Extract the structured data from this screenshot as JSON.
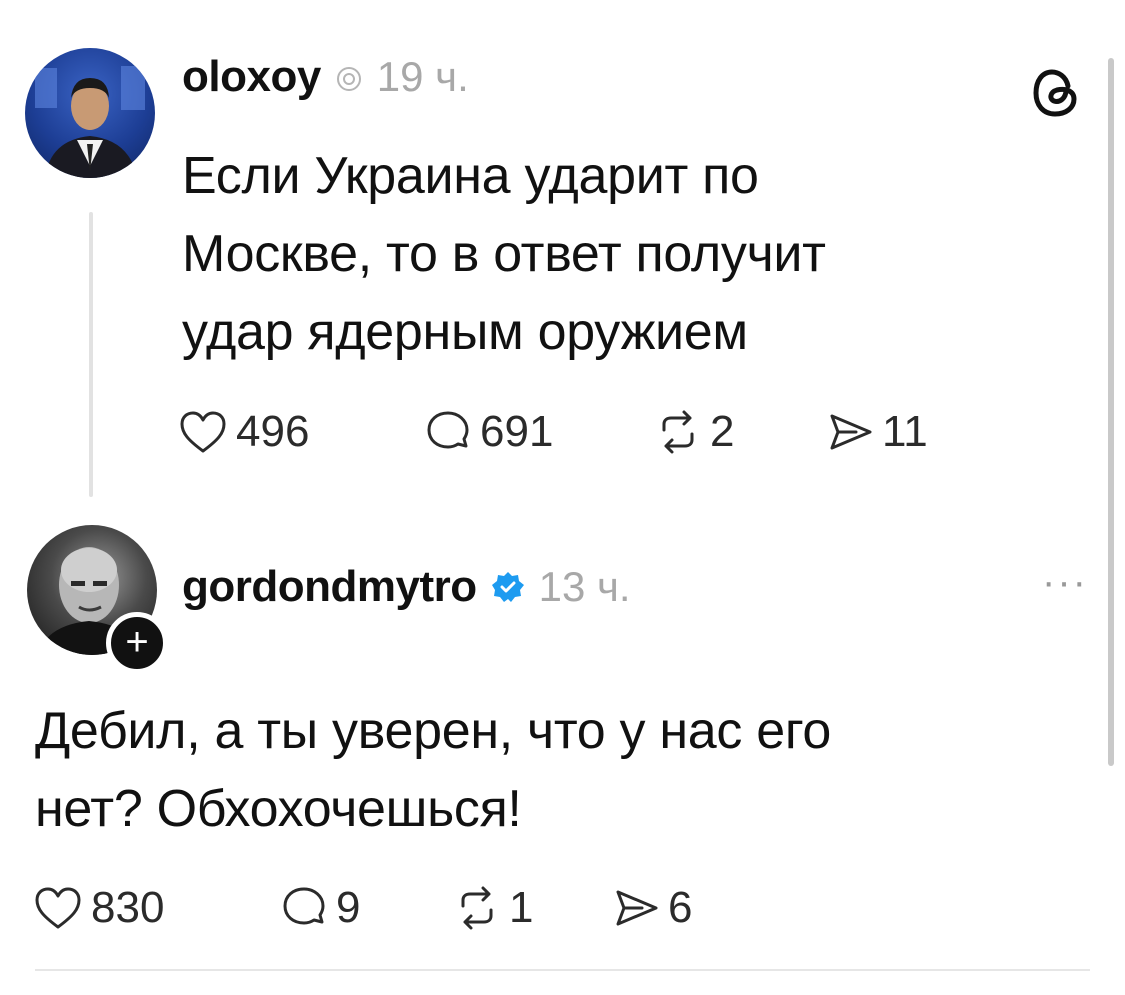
{
  "posts": [
    {
      "username": "oloxoy",
      "time": "19 ч.",
      "text_lines": [
        "Если Украина ударит по",
        "Москве, то в ответ получит",
        "удар ядерным оружием"
      ],
      "likes": "496",
      "replies": "691",
      "reposts": "2",
      "shares": "11"
    },
    {
      "username": "gordondmytro",
      "time": "13 ч.",
      "verified": true,
      "text_lines": [
        "Дебил, а ты уверен, что у нас его",
        "нет? Обхохочешься!"
      ],
      "likes": "830",
      "replies": "9",
      "reposts": "1",
      "shares": "6",
      "follow_badge": "+",
      "more_menu": "···"
    }
  ],
  "colors": {
    "text": "#111111",
    "muted": "#a8a8a8",
    "verified": "#1d9bf0",
    "avatar1_bg": "#1d3e95"
  },
  "icons": [
    "threads-logo-icon",
    "heart-icon",
    "comment-icon",
    "repost-icon",
    "share-icon",
    "verified-badge-icon",
    "threads-badge-icon"
  ]
}
